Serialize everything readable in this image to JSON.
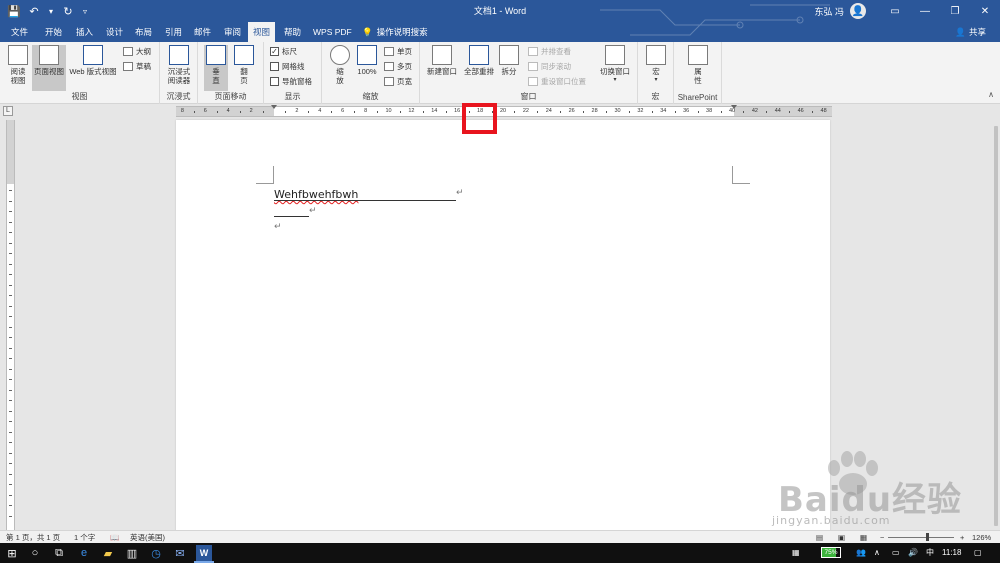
{
  "window": {
    "title": "文档1 - Word",
    "user": "东弘 冯"
  },
  "tabs": [
    {
      "label": "文件",
      "active": false
    },
    {
      "label": "开始",
      "active": false
    },
    {
      "label": "插入",
      "active": false
    },
    {
      "label": "设计",
      "active": false
    },
    {
      "label": "布局",
      "active": false
    },
    {
      "label": "引用",
      "active": false
    },
    {
      "label": "邮件",
      "active": false
    },
    {
      "label": "审阅",
      "active": false
    },
    {
      "label": "视图",
      "active": true
    },
    {
      "label": "帮助",
      "active": false
    },
    {
      "label": "WPS PDF",
      "active": false
    }
  ],
  "tell_me": "操作说明搜索",
  "share": "共享",
  "ribbon": {
    "views": {
      "label": "视图",
      "read_mode": "阅读\n视图",
      "print_layout": "页面视图",
      "web_layout": "Web 版式视图",
      "outline": "大纲",
      "draft": "草稿"
    },
    "immersive": {
      "label": "沉浸式",
      "immersive_reader": "沉浸式\n阅读器"
    },
    "page_movement": {
      "label": "页面移动",
      "vertical": "垂\n直",
      "side_to_side": "翻\n页"
    },
    "show": {
      "label": "显示",
      "ruler": "标尺",
      "ruler_checked": true,
      "gridlines": "网格线",
      "gridlines_checked": false,
      "navigation_pane": "导航窗格",
      "navigation_checked": false
    },
    "zoom": {
      "label": "缩放",
      "zoom": "缩\n放",
      "percent100": "100%",
      "one_page": "单页",
      "multiple_pages": "多页",
      "page_width": "页宽"
    },
    "window": {
      "label": "窗口",
      "new_window": "新建窗口",
      "arrange_all": "全部重排",
      "split": "拆分",
      "side_by_side": "并排查看",
      "sync_scrolling": "同步滚动",
      "reset_position": "重设窗口位置",
      "switch_windows": "切换窗口"
    },
    "macros": {
      "label": "宏",
      "macros": "宏"
    },
    "sharepoint": {
      "label": "SharePoint",
      "properties": "属\n性"
    }
  },
  "ruler": {
    "labels": [
      "8",
      "6",
      "4",
      "2",
      "",
      "2",
      "4",
      "6",
      "8",
      "10",
      "12",
      "14",
      "16",
      "18",
      "20",
      "22",
      "24",
      "26",
      "28",
      "30",
      "32",
      "34",
      "36",
      "38",
      "40",
      "42",
      "44",
      "46",
      "48"
    ]
  },
  "document": {
    "line1": "Wehfbwehfbwh",
    "para_mark": "↵"
  },
  "statusbar": {
    "page": "第 1 页，共 1 页",
    "words": "1 个字",
    "language": "英语(美国)",
    "zoom": "126%"
  },
  "taskbar": {
    "battery": "75%",
    "ime": "中",
    "time": "11:18"
  },
  "watermark": {
    "brand": "Baidu经验",
    "url": "jingyan.baidu.com"
  },
  "colors": {
    "word_blue": "#2b579a",
    "highlight_red": "#e8141e",
    "spell_red": "#e31b1b"
  }
}
